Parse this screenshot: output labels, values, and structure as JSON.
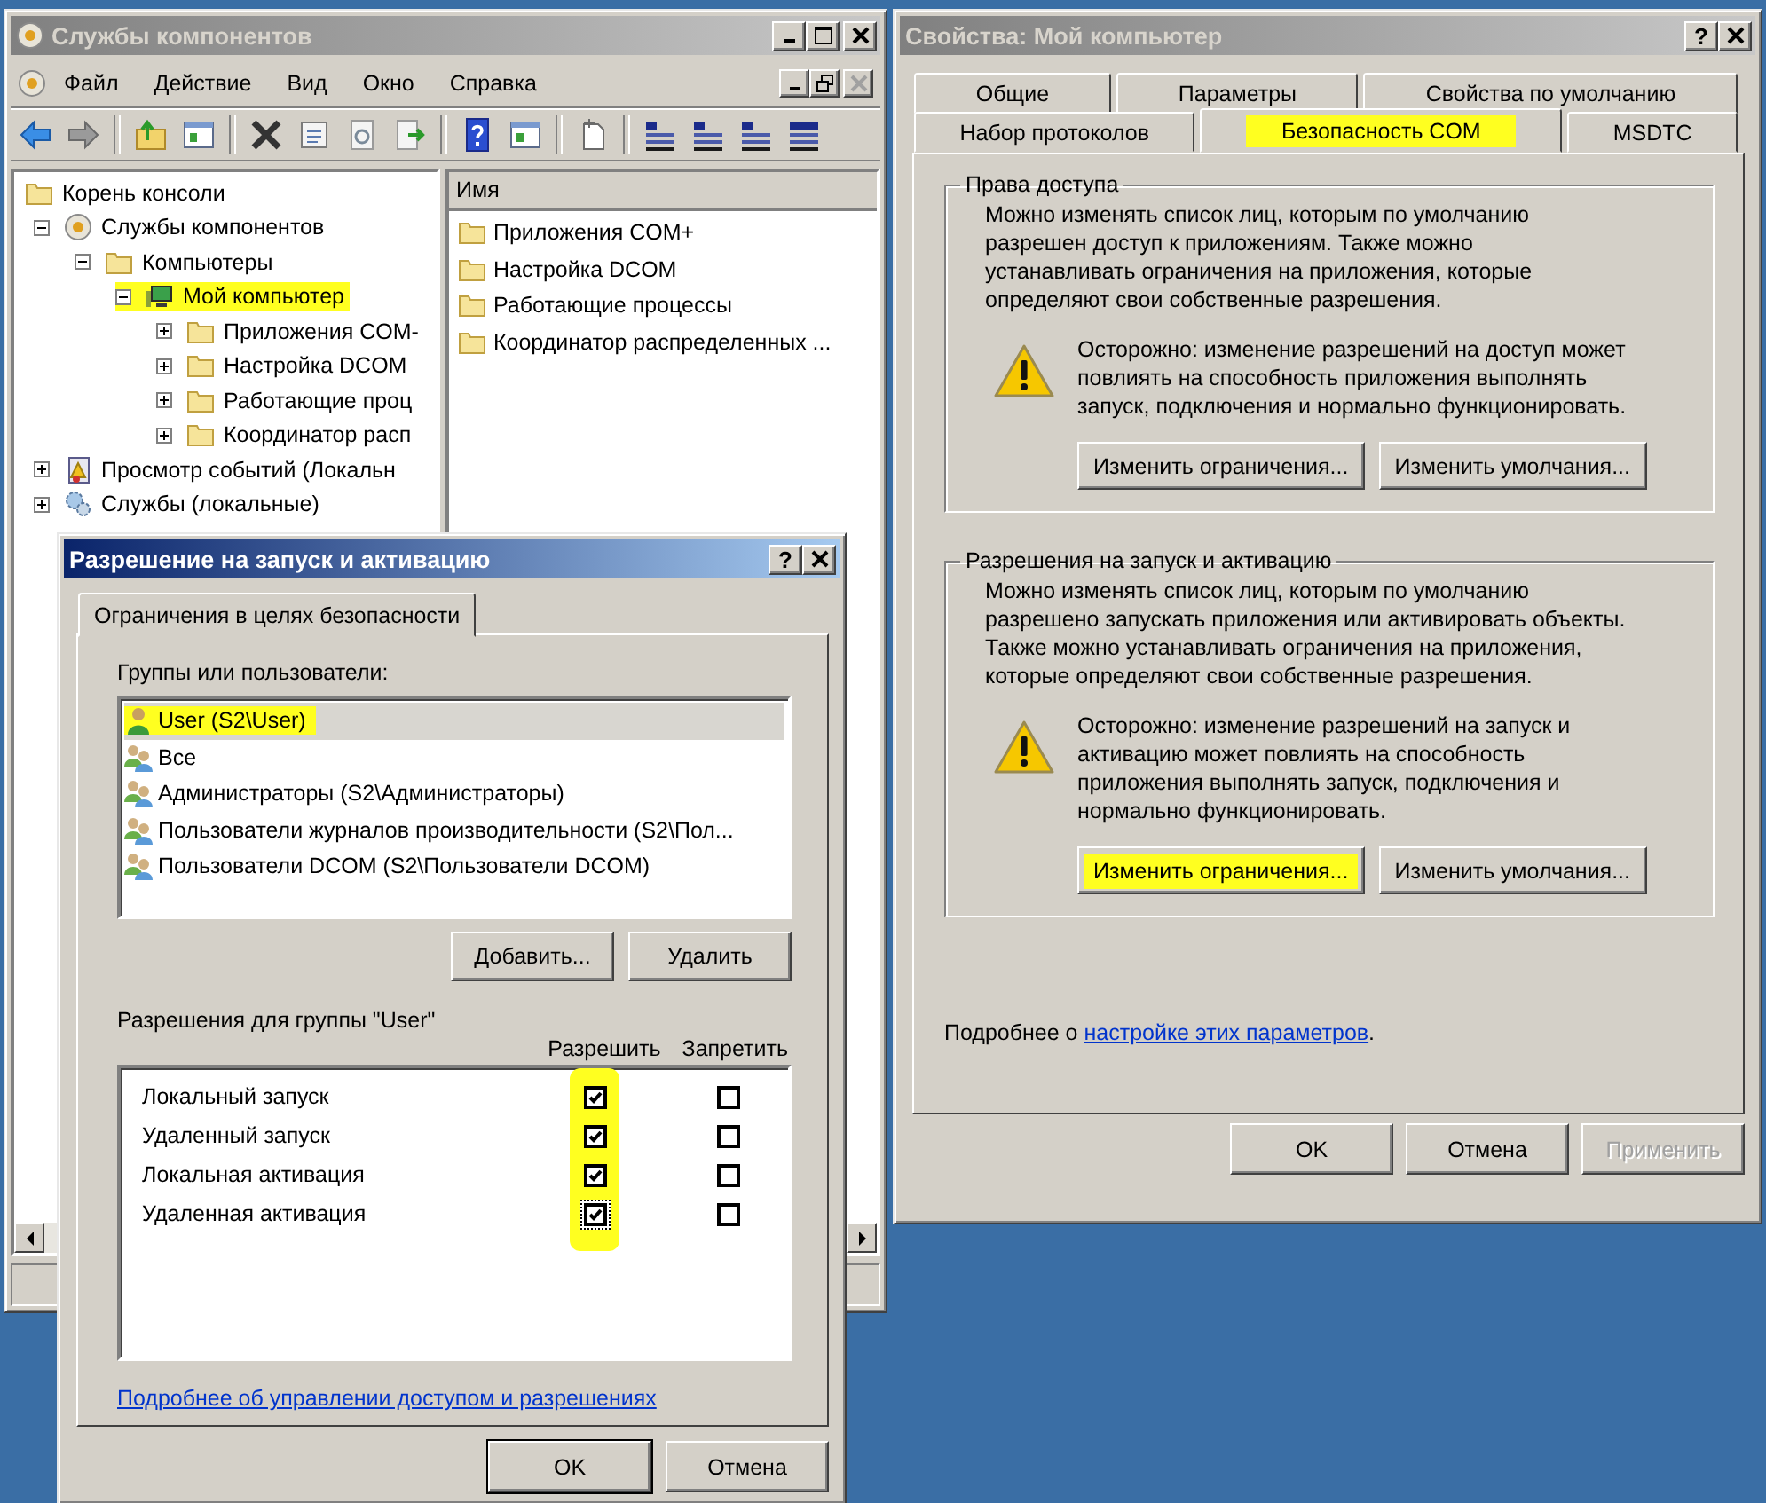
{
  "component_services": {
    "title": "Службы компонентов",
    "active": false,
    "menu": [
      "Файл",
      "Действие",
      "Вид",
      "Окно",
      "Справка"
    ],
    "tree": [
      {
        "label": "Корень консоли",
        "kind": "folder",
        "highlighted": false,
        "children": [
          {
            "label": "Службы компонентов",
            "kind": "services",
            "expanded": true,
            "highlighted": false,
            "children": [
              {
                "label": "Компьютеры",
                "kind": "folder",
                "expanded": true,
                "highlighted": false,
                "children": [
                  {
                    "label": "Мой компьютер",
                    "kind": "computer",
                    "expanded": true,
                    "highlighted": true,
                    "children": [
                      {
                        "label": "Приложения COM-",
                        "kind": "folder",
                        "expanded": false,
                        "highlighted": false
                      },
                      {
                        "label": "Настройка DCOM",
                        "kind": "folder",
                        "expanded": false,
                        "highlighted": false
                      },
                      {
                        "label": "Работающие проц",
                        "kind": "folder",
                        "expanded": false,
                        "highlighted": false
                      },
                      {
                        "label": "Координатор расп",
                        "kind": "folder",
                        "expanded": false,
                        "highlighted": false
                      }
                    ]
                  }
                ]
              }
            ]
          },
          {
            "label": "Просмотр событий (Локальн",
            "kind": "events",
            "expanded": false,
            "highlighted": false
          },
          {
            "label": "Службы (локальные)",
            "kind": "gear",
            "expanded": false,
            "highlighted": false
          }
        ]
      }
    ],
    "list_header": "Имя",
    "list_items": [
      "Приложения COM+",
      "Настройка DCOM",
      "Работающие процессы",
      "Координатор распределенных ..."
    ]
  },
  "properties": {
    "title": "Свойства: Мой компьютер",
    "active": false,
    "help": "?",
    "tab_rows": [
      [
        {
          "label": "Общие",
          "selected": false,
          "highlighted": false
        },
        {
          "label": "Параметры",
          "selected": false,
          "highlighted": false
        },
        {
          "label": "Свойства по умолчанию",
          "selected": false,
          "highlighted": false
        }
      ],
      [
        {
          "label": "Набор протоколов",
          "selected": false,
          "highlighted": false
        },
        {
          "label": "Безопасность COM",
          "selected": true,
          "highlighted": true
        },
        {
          "label": "MSDTC",
          "selected": false,
          "highlighted": false
        }
      ]
    ],
    "groups": [
      {
        "title": "Права доступа",
        "text": "Можно изменять список лиц, которым по умолчанию\nразрешен доступ к приложениям. Также можно\nустанавливать ограничения на приложения, которые\nопределяют свои собственные разрешения.",
        "warning": "Осторожно: изменение разрешений на доступ может\nповлиять на способность приложения выполнять\nзапуск, подключения и нормально функционировать.",
        "buttons": [
          {
            "label": "Изменить ограничения...",
            "highlighted": false
          },
          {
            "label": "Изменить умолчания...",
            "highlighted": false
          }
        ]
      },
      {
        "title": "Разрешения на запуск и активацию",
        "text": "Можно изменять список лиц, которым по умолчанию\nразрешено запускать приложения или активировать объекты.\nТакже можно устанавливать ограничения на приложения,\nкоторые определяют свои собственные разрешения.",
        "warning": "Осторожно: изменение разрешений на запуск и\nактивацию может повлиять на способность\nприложения выполнять запуск, подключения и\nнормально функционировать.",
        "buttons": [
          {
            "label": "Изменить ограничения...",
            "highlighted": true
          },
          {
            "label": "Изменить умолчания...",
            "highlighted": false
          }
        ]
      }
    ],
    "more_prefix": "Подробнее о",
    "more_link": "настройке этих параметров",
    "more_suffix": ".",
    "buttons": [
      {
        "label": "OK",
        "disabled": false
      },
      {
        "label": "Отмена",
        "disabled": false
      },
      {
        "label": "Применить",
        "disabled": true
      }
    ]
  },
  "dialog": {
    "title": "Разрешение на запуск и активацию",
    "active": true,
    "help": "?",
    "tabs": [
      {
        "label": "Ограничения в целях безопасности",
        "selected": true
      }
    ],
    "users_label": "Группы или пользователи:",
    "users": [
      {
        "name": "User (S2\\User)",
        "kind": "user",
        "selected": true,
        "highlighted": true
      },
      {
        "name": "Все",
        "kind": "group",
        "selected": false,
        "highlighted": false
      },
      {
        "name": "Администраторы (S2\\Администраторы)",
        "kind": "group",
        "selected": false,
        "highlighted": false
      },
      {
        "name": "Пользователи журналов производительности (S2\\Пол...",
        "kind": "group",
        "selected": false,
        "highlighted": false
      },
      {
        "name": "Пользователи DCOM (S2\\Пользователи DCOM)",
        "kind": "group",
        "selected": false,
        "highlighted": false
      }
    ],
    "user_buttons": [
      "Добавить...",
      "Удалить"
    ],
    "permissions_label": "Разрешения для группы \"User\"",
    "columns": [
      "Разрешить",
      "Запретить"
    ],
    "allow_column_highlighted": true,
    "permissions": [
      {
        "label": "Локальный запуск",
        "allow": true,
        "deny": false,
        "focused": false
      },
      {
        "label": "Удаленный запуск",
        "allow": true,
        "deny": false,
        "focused": false
      },
      {
        "label": "Локальная активация",
        "allow": true,
        "deny": false,
        "focused": false
      },
      {
        "label": "Удаленная активация",
        "allow": true,
        "deny": false,
        "focused": true
      }
    ],
    "help_link": "Подробнее об управлении доступом и разрешениях",
    "buttons": [
      {
        "label": "OK",
        "default": true
      },
      {
        "label": "Отмена",
        "default": false
      }
    ]
  }
}
